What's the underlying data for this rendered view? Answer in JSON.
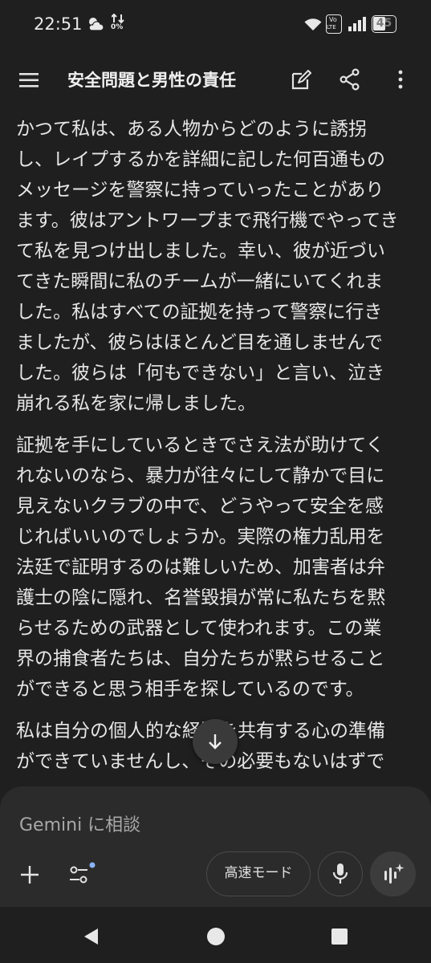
{
  "status": {
    "time": "22:51",
    "data_speed": "0%",
    "volte_top": "Vo",
    "volte_bottom": "LTE",
    "battery": "45"
  },
  "topbar": {
    "title": "安全問題と男性の責任"
  },
  "content": {
    "paragraphs": [
      "かつて私は、ある人物からどのように誘拐\nし、レイプするかを詳細に記した何百通もの\nメッセージを警察に持っていったことがあり\nます。彼はアントワープまで飛行機でやってき\nて私を見つけ出しました。幸い、彼が近づい\nてきた瞬間に私のチームが一緒にいてくれま\nした。私はすべての証拠を持って警察に行き\nましたが、彼らはほとんど目を通しませんで\nした。彼らは「何もできない」と言い、泣き\n崩れる私を家に帰しました。",
      "証拠を手にしているときでさえ法が助けてく\nれないのなら、暴力が往々にして静かで目に\n見えないクラブの中で、どうやって安全を感\nじればいいのでしょうか。実際の権力乱用を\n法廷で証明するのは難しいため、加害者は弁\n護士の陰に隠れ、名誉毀損が常に私たちを黙\nらせるための武器として使われます。この業\n界の捕食者たちは、自分たちが黙らせること\nができると思う相手を探しているのです。",
      "私は自分の個人的な経験を共有する心の準備\nができていませんし、その必要もないはずで"
    ]
  },
  "composer": {
    "placeholder": "Gemini に相談",
    "mode_label": "高速モード"
  },
  "icons": {
    "menu": "menu-icon",
    "edit": "edit-icon",
    "share": "share-icon",
    "more": "more-vert-icon",
    "scroll_down": "arrow-down-icon",
    "add": "plus-icon",
    "tools": "tune-icon",
    "mic": "mic-icon",
    "live": "live-sparkle-icon",
    "back": "nav-back-icon",
    "home": "nav-home-icon",
    "recents": "nav-recents-icon"
  },
  "colors": {
    "background": "#1f1f1f",
    "composer": "#2b2b2b",
    "accent_dot": "#8ab4f8",
    "text": "#e3e3e3"
  }
}
